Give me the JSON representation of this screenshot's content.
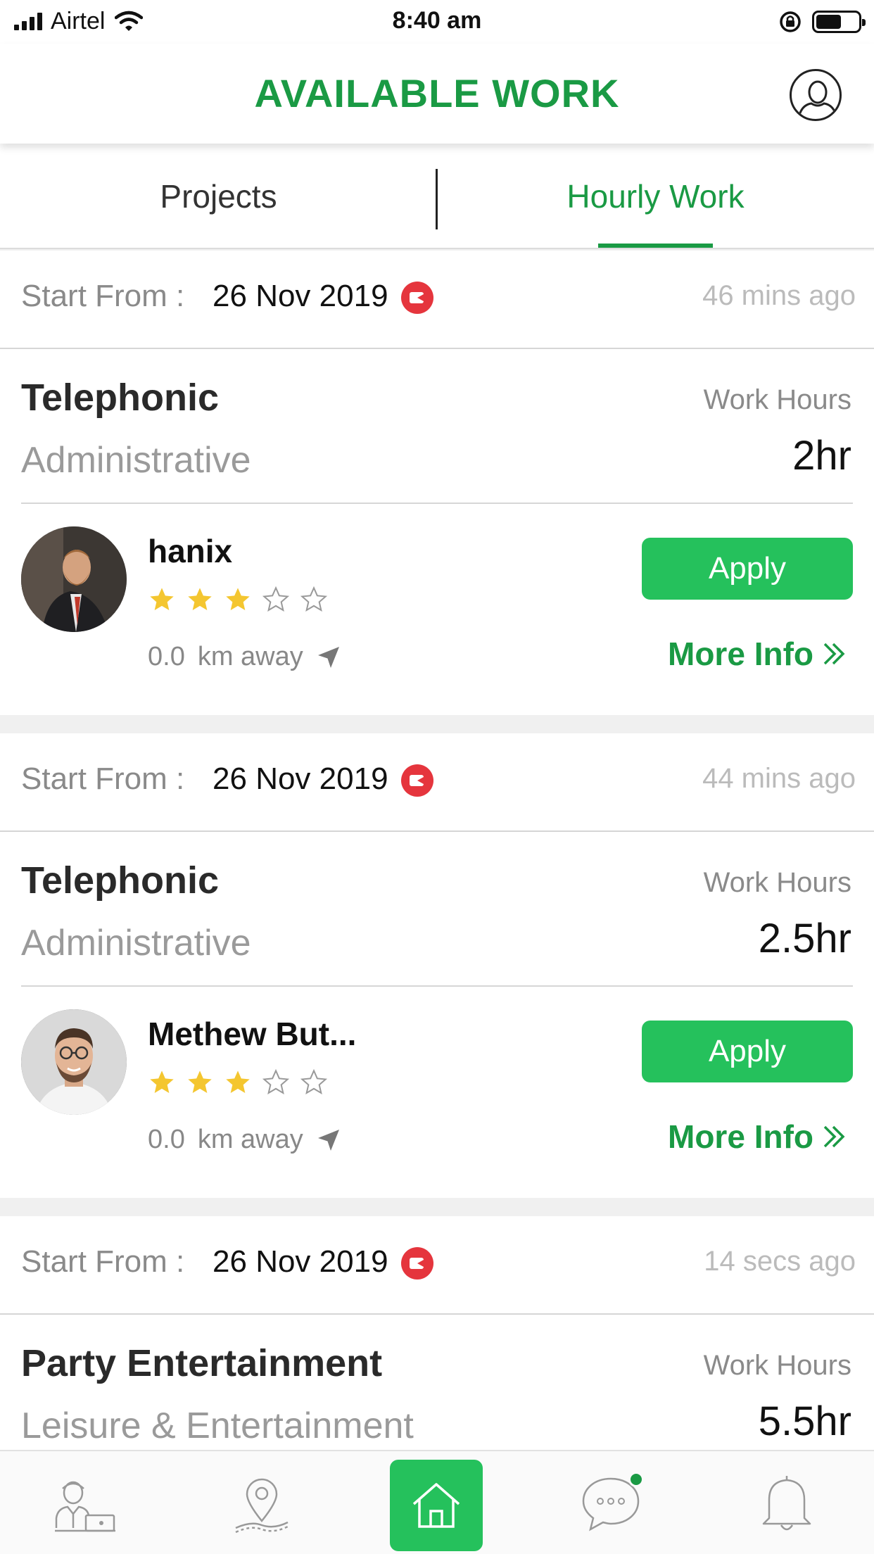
{
  "status_bar": {
    "carrier": "Airtel",
    "time": "8:40 am"
  },
  "header": {
    "title": "AVAILABLE WORK"
  },
  "tabs": [
    {
      "label": "Projects",
      "active": false
    },
    {
      "label": "Hourly Work",
      "active": true
    }
  ],
  "colors": {
    "brand_green": "#1a9a44",
    "button_green": "#25c15c",
    "video_red": "#e5353d",
    "star_gold": "#f4c630"
  },
  "jobs": [
    {
      "start_label": "Start From :",
      "start_day": "26",
      "start_month_year": "Nov 2019",
      "posted_ago": "46 mins ago",
      "title": "Telephonic",
      "category": "Administrative",
      "hours_label": "Work Hours",
      "hours": "2hr",
      "user_name": "hanix",
      "rating": 3,
      "rating_max": 5,
      "distance_value": "0.0",
      "distance_unit": "km away",
      "apply_label": "Apply",
      "more_info_label": "More Info"
    },
    {
      "start_label": "Start From :",
      "start_day": "26",
      "start_month_year": "Nov 2019",
      "posted_ago": "44 mins ago",
      "title": "Telephonic",
      "category": "Administrative",
      "hours_label": "Work Hours",
      "hours": "2.5hr",
      "user_name": "Methew But...",
      "rating": 3,
      "rating_max": 5,
      "distance_value": "0.0",
      "distance_unit": "km away",
      "apply_label": "Apply",
      "more_info_label": "More Info"
    },
    {
      "start_label": "Start From :",
      "start_day": "26",
      "start_month_year": "Nov 2019",
      "posted_ago": "14 secs ago",
      "title": "Party Entertainment",
      "category": "Leisure & Entertainment",
      "hours_label": "Work Hours",
      "hours": "5.5hr"
    }
  ],
  "bottom_nav": [
    {
      "icon": "worker-icon"
    },
    {
      "icon": "map-pin-icon"
    },
    {
      "icon": "home-icon",
      "active": true
    },
    {
      "icon": "chat-icon",
      "badge": true
    },
    {
      "icon": "bell-icon"
    }
  ]
}
